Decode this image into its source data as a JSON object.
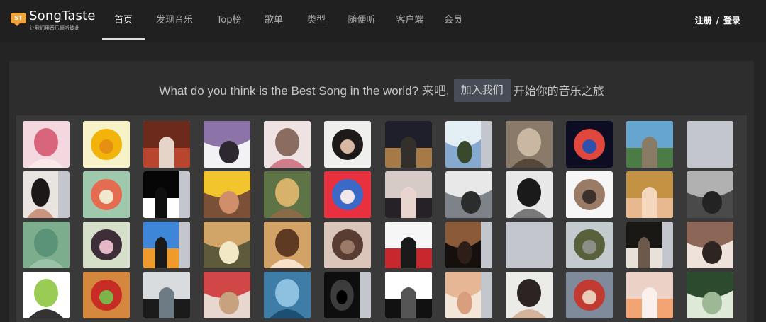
{
  "header": {
    "logo": {
      "badge": "ST",
      "name": "SongTaste",
      "slogan": "让我们用音乐倾听彼此"
    },
    "nav": [
      {
        "label": "首页",
        "active": true
      },
      {
        "label": "发现音乐"
      },
      {
        "label": "Top榜"
      },
      {
        "label": "歌单"
      },
      {
        "label": "类型"
      },
      {
        "label": "随便听"
      },
      {
        "label": "客户端"
      },
      {
        "label": "会员"
      }
    ],
    "auth": {
      "register": "注册",
      "separator": "/",
      "login": "登录"
    }
  },
  "main": {
    "tagline_prefix": "What do you think is the Best Song in the world? 来吧,",
    "join_button": "加入我们",
    "tagline_suffix": "开始你的音乐之旅"
  },
  "avatars": [
    {
      "icon": "anime-pink-hair-girl-avatar",
      "colors": [
        "#f3d9df",
        "#d9657c",
        "#fbe9ea"
      ]
    },
    {
      "icon": "yellow-smiley-face-avatar",
      "colors": [
        "#f7f2c8",
        "#f2b40a",
        "#e58f14"
      ]
    },
    {
      "icon": "courtroom-judge-avatar",
      "colors": [
        "#6b2a1c",
        "#b8452e",
        "#e7d4c9"
      ]
    },
    {
      "icon": "anime-purple-hair-girl-avatar",
      "colors": [
        "#f2f2f4",
        "#8d74a8",
        "#2d2830"
      ]
    },
    {
      "icon": "woman-portrait-avatar",
      "colors": [
        "#eee3e2",
        "#8b6c60",
        "#d17d8b"
      ]
    },
    {
      "icon": "woman-long-hair-avatar",
      "colors": [
        "#efefed",
        "#1d1a19",
        "#d9b8a4"
      ]
    },
    {
      "icon": "night-city-woman-avatar",
      "colors": [
        "#1e1f2a",
        "#a57a46",
        "#33302c"
      ]
    },
    {
      "icon": "landscape-sky-avatar",
      "colors": [
        "#86a9cf",
        "#e4eef5",
        "#38492c"
      ],
      "partial": true
    },
    {
      "icon": "sepia-artwork-avatar",
      "colors": [
        "#8a7a6a",
        "#c9b7a2",
        "#564839"
      ]
    },
    {
      "icon": "neon-ring-avatar",
      "colors": [
        "#0c0d22",
        "#e1483d",
        "#2f50ad"
      ]
    },
    {
      "icon": "flying-castle-avatar",
      "colors": [
        "#65a5d0",
        "#4c7c45",
        "#8a7b67"
      ]
    },
    {
      "icon": "blank-avatar",
      "colors": [
        "#c3c6cd",
        "#c3c6cd",
        "#c3c6cd"
      ]
    },
    {
      "icon": "woman-sunglasses-avatar",
      "colors": [
        "#e9e4df",
        "#1b1817",
        "#c99581"
      ],
      "partial": true
    },
    {
      "icon": "stacked-tower-avatar",
      "colors": [
        "#9fc9ad",
        "#e46c51",
        "#f1e7cc"
      ]
    },
    {
      "icon": "hat-mask-avatar",
      "colors": [
        "#060606",
        "#ffffff",
        "#0f0f0f"
      ],
      "partial": true
    },
    {
      "icon": "boy-eating-corn-avatar",
      "colors": [
        "#7a5137",
        "#f3c52d",
        "#d08e6b"
      ]
    },
    {
      "icon": "child-outdoors-avatar",
      "colors": [
        "#5e7447",
        "#d6b26a",
        "#8a6b48"
      ]
    },
    {
      "icon": "harley-quinn-avatar",
      "colors": [
        "#e8303e",
        "#3c68c6",
        "#f2e7e9"
      ]
    },
    {
      "icon": "anime-black-hair-girl-avatar",
      "colors": [
        "#d6cbc6",
        "#262027",
        "#e9d5d0"
      ]
    },
    {
      "icon": "panda-street-avatar",
      "colors": [
        "#7d8389",
        "#e8e8e8",
        "#2b2c2c"
      ]
    },
    {
      "icon": "manga-bw-avatar",
      "colors": [
        "#e8e8e8",
        "#1a1a1a",
        "#7a7a7a"
      ]
    },
    {
      "icon": "man-beard-avatar",
      "colors": [
        "#f6f6f6",
        "#9a7b66",
        "#3b302a"
      ]
    },
    {
      "icon": "bald-cartoon-baby-avatar",
      "colors": [
        "#c39343",
        "#e8b88f",
        "#f5d7bd"
      ]
    },
    {
      "icon": "koala-avatar",
      "colors": [
        "#4a4a4a",
        "#b1b1b1",
        "#232323"
      ]
    },
    {
      "icon": "green-texture-avatar",
      "colors": [
        "#7cae8d",
        "#5b9378",
        "#9cc2a9"
      ]
    },
    {
      "icon": "anime-girl-flowers-avatar",
      "colors": [
        "#d5dfc9",
        "#3d2e38",
        "#e4b8c7"
      ]
    },
    {
      "icon": "sunset-silhouette-avatar",
      "colors": [
        "#3e87d8",
        "#ef9a2a",
        "#1a1a1a"
      ],
      "partial": true
    },
    {
      "icon": "cat-meme-avatar",
      "colors": [
        "#5e5b3c",
        "#d1a468",
        "#f2e8c5"
      ]
    },
    {
      "icon": "cartoon-boy-avatar",
      "colors": [
        "#d3a267",
        "#5f3a22",
        "#f7e1c9"
      ]
    },
    {
      "icon": "woman-hand-face-avatar",
      "colors": [
        "#d9c5b9",
        "#5a3d32",
        "#9c7a68"
      ]
    },
    {
      "icon": "opera-mask-avatar",
      "colors": [
        "#f6f6f6",
        "#c8282d",
        "#1a1a1a"
      ]
    },
    {
      "icon": "dark-hand-avatar",
      "colors": [
        "#15100e",
        "#8a5a39",
        "#2d1f18"
      ],
      "partial": true
    },
    {
      "icon": "blank-avatar",
      "colors": [
        "#c3c6cd",
        "#c3c6cd",
        "#c3c6cd"
      ]
    },
    {
      "icon": "field-landscape-avatar",
      "colors": [
        "#c4cbcf",
        "#58613b",
        "#8b8f85"
      ]
    },
    {
      "icon": "dog-face-avatar",
      "colors": [
        "#1a1815",
        "#e8e1d7",
        "#6b5a4c"
      ],
      "partial": true
    },
    {
      "icon": "couple-avatar",
      "colors": [
        "#efe2da",
        "#8c6656",
        "#2e2522"
      ]
    },
    {
      "icon": "glasses-boy-cartoon-avatar",
      "colors": [
        "#ffffff",
        "#9acb54",
        "#333333"
      ]
    },
    {
      "icon": "pixel-burger-avatar",
      "colors": [
        "#d5873e",
        "#c72d24",
        "#7cb449"
      ]
    },
    {
      "icon": "office-desk-avatar",
      "colors": [
        "#d8dcdf",
        "#1b1b1b",
        "#6d7b84"
      ]
    },
    {
      "icon": "blonde-woman-avatar",
      "colors": [
        "#e8d7cf",
        "#d14646",
        "#c8a27e"
      ]
    },
    {
      "icon": "underwater-avatar",
      "colors": [
        "#3d7da8",
        "#8dc1df",
        "#1d4f72"
      ]
    },
    {
      "icon": "dark-creature-avatar",
      "colors": [
        "#0e0e0e",
        "#3c3c3c",
        "#000000"
      ],
      "partial": true
    },
    {
      "icon": "line-art-face-avatar",
      "colors": [
        "#ffffff",
        "#111111",
        "#555555"
      ]
    },
    {
      "icon": "baby-avatar",
      "colors": [
        "#f4e5d9",
        "#e7b795",
        "#d99e7e"
      ],
      "partial": true
    },
    {
      "icon": "man-scarf-avatar",
      "colors": [
        "#ebebe8",
        "#2b2422",
        "#d4b49b"
      ]
    },
    {
      "icon": "girl-balloons-avatar",
      "colors": [
        "#7f8b9b",
        "#c23b32",
        "#e9cdb8"
      ]
    },
    {
      "icon": "cute-cat-avatar",
      "colors": [
        "#ecd1c7",
        "#f3a473",
        "#fbf1ec"
      ]
    },
    {
      "icon": "green-sketch-pattern-avatar",
      "colors": [
        "#dfe9d8",
        "#2c4a2d",
        "#9cb894"
      ]
    }
  ]
}
